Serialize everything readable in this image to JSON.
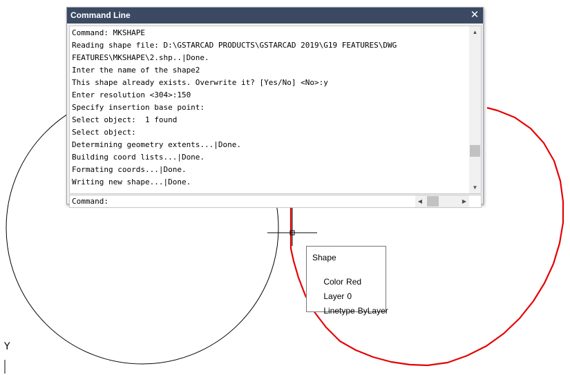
{
  "drawing": {
    "shapes": [
      "circle",
      "polygon-circle"
    ],
    "colors": {
      "background": "#ffffff",
      "circle": "#000000",
      "selected_shape": "#e60000",
      "crosshair": "#000000"
    },
    "ucs_axis_label": "Y"
  },
  "command_window": {
    "title": "Command Line",
    "close_icon": "close-icon",
    "history": [
      "Command: MKSHAPE",
      "Reading shape file: D:\\GSTARCAD PRODUCTS\\GSTARCAD 2019\\G19 FEATURES\\DWG",
      "FEATURES\\MKSHAPE\\2.shp..|Done.",
      "Inter the name of the shape2",
      "This shape already exists. Overwrite it? [Yes/No] <No>:y",
      "Enter resolution <304>:150",
      "Specify insertion base point:",
      "Select object:  1 found",
      "Select object:",
      "Determining geometry extents...|Done.",
      "Building coord lists...|Done.",
      "Formating coords...|Done.",
      "Writing new shape...|Done."
    ],
    "prompt": "Command:",
    "colors": {
      "titlebar": "#3b4a62",
      "title_text": "#ffffff"
    }
  },
  "tooltip": {
    "title": "Shape",
    "rows": [
      {
        "label": "Color",
        "value": "Red"
      },
      {
        "label": "Layer",
        "value": "0"
      },
      {
        "label": "Linetype",
        "value": "ByLayer"
      }
    ]
  }
}
